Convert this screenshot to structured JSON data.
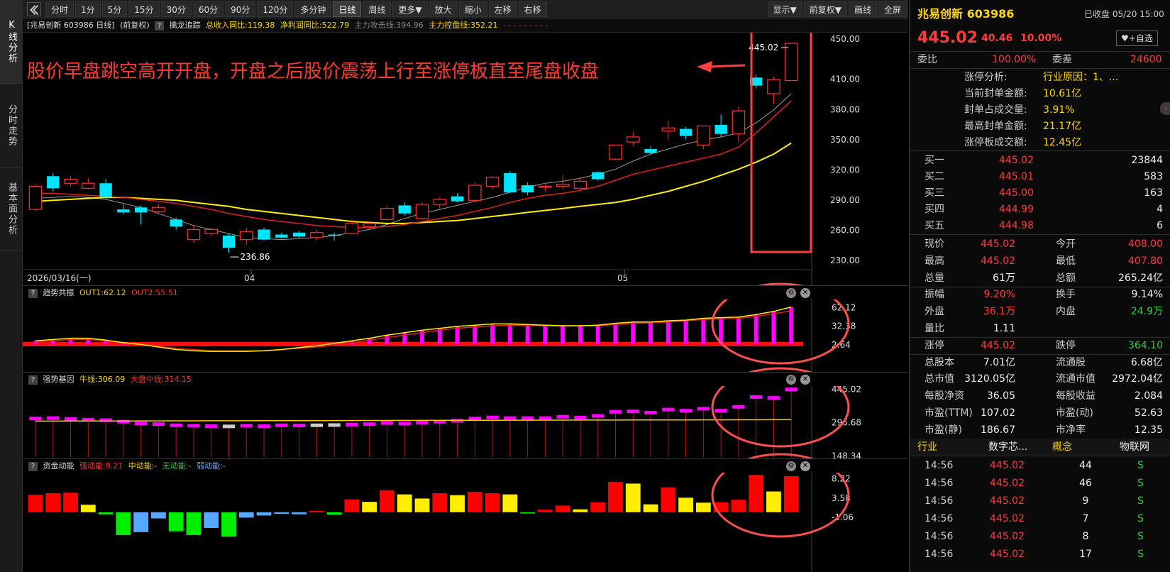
{
  "left_tabs": [
    "K线分析",
    "分时走势",
    "基本面分析"
  ],
  "toolbar": {
    "buttons": [
      "分时",
      "1分",
      "5分",
      "15分",
      "30分",
      "60分",
      "90分",
      "120分",
      "多分钟",
      "日线",
      "周线",
      "更多▼",
      "放大",
      "缩小",
      "左移",
      "右移"
    ],
    "active": "日线",
    "right_buttons": [
      "显示▼",
      "前复权▼",
      "画线",
      "全屏"
    ]
  },
  "infobar": {
    "title": "[兆易创新 603986 日线]",
    "adjust": "(前复权)",
    "indicator": "擒龙追踪",
    "revenue_yoy": "总收入同比:119.38",
    "profit_yoy": "净利润同比:522.79",
    "attack_line": "主力攻击线:394.96",
    "control_line": "主力控盘线:352.21",
    "extra": "- - - - - - - - -"
  },
  "annotation": {
    "text": "股价早盘跳空高开开盘，开盘之后股价震荡上行至涨停板直至尾盘收盘",
    "color": "#ff3b30"
  },
  "main_chart": {
    "y_ticks": [
      "450.00",
      "410.00",
      "380.00",
      "350.00",
      "320.00",
      "290.00",
      "260.00",
      "230.00"
    ],
    "x_labels": [
      "2026/03/16(一)",
      "04",
      "05"
    ],
    "high_label": "445.02",
    "low_label": "236.86"
  },
  "panel1": {
    "name": "趋势共振",
    "out1": "OUT1:62.12",
    "out2": "OUT2:55.51",
    "y_ticks": [
      "62.12",
      "32.38",
      "2.64"
    ]
  },
  "panel2": {
    "name": "强势基因",
    "bull": "牛线:306.09",
    "market": "大盘中线:314.15",
    "y_ticks": [
      "445.02",
      "296.68",
      "148.34"
    ]
  },
  "panel3": {
    "name": "资金动能",
    "strong": "强动能:8.21",
    "mid": "中动能:-",
    "none": "无动能:-",
    "weak": "弱动能:-",
    "y_ticks": [
      "8.22",
      "3.58",
      "-1.06"
    ]
  },
  "chart_data": {
    "type": "candlestick",
    "candles": [
      {
        "o": 280,
        "h": 305,
        "l": 278,
        "c": 303
      },
      {
        "o": 313,
        "h": 316,
        "l": 298,
        "c": 301
      },
      {
        "o": 306,
        "h": 313,
        "l": 303,
        "c": 310
      },
      {
        "o": 301,
        "h": 311,
        "l": 300,
        "c": 306
      },
      {
        "o": 306,
        "h": 310,
        "l": 290,
        "c": 292
      },
      {
        "o": 280,
        "h": 285,
        "l": 275,
        "c": 277
      },
      {
        "o": 282,
        "h": 284,
        "l": 265,
        "c": 277
      },
      {
        "o": 278,
        "h": 285,
        "l": 275,
        "c": 282
      },
      {
        "o": 270,
        "h": 272,
        "l": 260,
        "c": 263
      },
      {
        "o": 250,
        "h": 265,
        "l": 247,
        "c": 260
      },
      {
        "o": 256,
        "h": 262,
        "l": 253,
        "c": 260
      },
      {
        "o": 254,
        "h": 256,
        "l": 237,
        "c": 242
      },
      {
        "o": 250,
        "h": 262,
        "l": 245,
        "c": 258
      },
      {
        "o": 260,
        "h": 262,
        "l": 249,
        "c": 250
      },
      {
        "o": 255,
        "h": 257,
        "l": 251,
        "c": 252
      },
      {
        "o": 257,
        "h": 259,
        "l": 251,
        "c": 253
      },
      {
        "o": 252,
        "h": 260,
        "l": 249,
        "c": 257
      },
      {
        "o": 255,
        "h": 257,
        "l": 249,
        "c": 254
      },
      {
        "o": 256,
        "h": 270,
        "l": 255,
        "c": 266
      },
      {
        "o": 263,
        "h": 268,
        "l": 260,
        "c": 266
      },
      {
        "o": 270,
        "h": 284,
        "l": 268,
        "c": 281
      },
      {
        "o": 284,
        "h": 287,
        "l": 274,
        "c": 276
      },
      {
        "o": 271,
        "h": 287,
        "l": 270,
        "c": 285
      },
      {
        "o": 285,
        "h": 292,
        "l": 281,
        "c": 290
      },
      {
        "o": 293,
        "h": 296,
        "l": 287,
        "c": 288
      },
      {
        "o": 289,
        "h": 307,
        "l": 287,
        "c": 304
      },
      {
        "o": 303,
        "h": 313,
        "l": 300,
        "c": 312
      },
      {
        "o": 316,
        "h": 318,
        "l": 297,
        "c": 297
      },
      {
        "o": 304,
        "h": 307,
        "l": 294,
        "c": 297
      },
      {
        "o": 302,
        "h": 305,
        "l": 298,
        "c": 303
      },
      {
        "o": 303,
        "h": 314,
        "l": 300,
        "c": 305
      },
      {
        "o": 301,
        "h": 312,
        "l": 299,
        "c": 308
      },
      {
        "o": 317,
        "h": 318,
        "l": 309,
        "c": 310
      },
      {
        "o": 330,
        "h": 343,
        "l": 329,
        "c": 344
      },
      {
        "o": 347,
        "h": 357,
        "l": 343,
        "c": 352
      },
      {
        "o": 340,
        "h": 343,
        "l": 335,
        "c": 336
      },
      {
        "o": 358,
        "h": 368,
        "l": 349,
        "c": 361
      },
      {
        "o": 360,
        "h": 362,
        "l": 350,
        "c": 353
      },
      {
        "o": 344,
        "h": 361,
        "l": 340,
        "c": 363
      },
      {
        "o": 364,
        "h": 374,
        "l": 352,
        "c": 355
      },
      {
        "o": 355,
        "h": 382,
        "l": 347,
        "c": 378
      },
      {
        "o": 411,
        "h": 414,
        "l": 400,
        "c": 403
      },
      {
        "o": 395,
        "h": 412,
        "l": 385,
        "c": 409
      },
      {
        "o": 408,
        "h": 445.02,
        "l": 407.8,
        "c": 445.02
      }
    ],
    "ma_red": [
      296,
      296,
      295,
      294,
      293,
      292,
      290,
      288,
      286,
      283,
      280,
      276,
      273,
      270,
      268,
      266,
      264,
      263,
      262,
      262,
      263,
      265,
      268,
      271,
      274,
      278,
      282,
      287,
      291,
      294,
      296,
      299,
      303,
      309,
      315,
      319,
      323,
      327,
      331,
      335,
      342,
      356,
      372,
      388
    ],
    "ma_yellow": [
      288,
      289,
      290,
      291,
      292,
      292,
      291,
      290,
      289,
      287,
      285,
      283,
      280,
      278,
      276,
      274,
      272,
      270,
      268,
      267,
      266,
      266,
      267,
      268,
      269,
      271,
      273,
      275,
      277,
      279,
      281,
      283,
      285,
      287,
      290,
      294,
      298,
      303,
      308,
      314,
      320,
      327,
      335,
      346
    ],
    "ma_gray": [
      291,
      292,
      293,
      292,
      290,
      286,
      282,
      276,
      270,
      264,
      260,
      256,
      252,
      251,
      250,
      251,
      252,
      254,
      257,
      260,
      265,
      271,
      276,
      280,
      284,
      288,
      292,
      297,
      302,
      306,
      308,
      311,
      315,
      320,
      328,
      335,
      340,
      345,
      349,
      352,
      356,
      366,
      379,
      395
    ],
    "osc_out1": [
      8,
      10,
      12,
      12,
      9,
      5,
      2,
      -2,
      -6,
      -8,
      -9,
      -9,
      -9,
      -8,
      -6,
      -3,
      0,
      4,
      8,
      12,
      17,
      21,
      25,
      28,
      31,
      33,
      35,
      35,
      34,
      33,
      32,
      32,
      33,
      36,
      38,
      38,
      40,
      41,
      44,
      45,
      46,
      50,
      55,
      62
    ],
    "osc_out2": [
      6,
      8,
      10,
      10,
      8,
      5,
      2,
      -1,
      -4,
      -6,
      -8,
      -8,
      -8,
      -8,
      -6,
      -4,
      -2,
      1,
      5,
      9,
      13,
      17,
      21,
      25,
      28,
      30,
      32,
      33,
      33,
      32,
      32,
      32,
      32,
      34,
      36,
      37,
      38,
      40,
      42,
      43,
      44,
      47,
      51,
      56
    ],
    "gene_blocks": [
      {
        "v": 310,
        "c": "#ff00ff"
      },
      {
        "v": 312,
        "c": "#ff00ff"
      },
      {
        "v": 308,
        "c": "#ff00ff"
      },
      {
        "v": 305,
        "c": "#ff00ff"
      },
      {
        "v": 303,
        "c": "#ff00ff"
      },
      {
        "v": 296,
        "c": "#ff00ff"
      },
      {
        "v": 288,
        "c": "#ff00ff"
      },
      {
        "v": 285,
        "c": "#ff00ff"
      },
      {
        "v": 280,
        "c": "#ff00ff"
      },
      {
        "v": 278,
        "c": "#ff00ff"
      },
      {
        "v": 276,
        "c": "#ff00ff"
      },
      {
        "v": 275,
        "c": "#cccccc"
      },
      {
        "v": 278,
        "c": "#ff00ff"
      },
      {
        "v": 276,
        "c": "#ff00ff"
      },
      {
        "v": 280,
        "c": "#ff00ff"
      },
      {
        "v": 279,
        "c": "#ff00ff"
      },
      {
        "v": 280,
        "c": "#cccccc"
      },
      {
        "v": 281,
        "c": "#cccccc"
      },
      {
        "v": 283,
        "c": "#ff00ff"
      },
      {
        "v": 285,
        "c": "#ff00ff"
      },
      {
        "v": 290,
        "c": "#ff00ff"
      },
      {
        "v": 288,
        "c": "#ff00ff"
      },
      {
        "v": 291,
        "c": "#ff00ff"
      },
      {
        "v": 296,
        "c": "#ff00ff"
      },
      {
        "v": 300,
        "c": "#ff00ff"
      },
      {
        "v": 310,
        "c": "#ff00ff"
      },
      {
        "v": 315,
        "c": "#ff00ff"
      },
      {
        "v": 312,
        "c": "#ff00ff"
      },
      {
        "v": 312,
        "c": "#ff00ff"
      },
      {
        "v": 312,
        "c": "#ff00ff"
      },
      {
        "v": 318,
        "c": "#ff00ff"
      },
      {
        "v": 314,
        "c": "#ff00ff"
      },
      {
        "v": 322,
        "c": "#ff00ff"
      },
      {
        "v": 340,
        "c": "#ff00ff"
      },
      {
        "v": 342,
        "c": "#ff00ff"
      },
      {
        "v": 336,
        "c": "#ff00ff"
      },
      {
        "v": 350,
        "c": "#ff00ff"
      },
      {
        "v": 345,
        "c": "#ff00ff"
      },
      {
        "v": 354,
        "c": "#ff00ff"
      },
      {
        "v": 345,
        "c": "#ff00ff"
      },
      {
        "v": 362,
        "c": "#ff00ff"
      },
      {
        "v": 406,
        "c": "#ff00ff"
      },
      {
        "v": 402,
        "c": "#ff00ff"
      },
      {
        "v": 440,
        "c": "#ff00ff"
      }
    ],
    "fund_bars": [
      {
        "v": 4.2,
        "c": "#ff0000"
      },
      {
        "v": 4.6,
        "c": "#ff0000"
      },
      {
        "v": 4.7,
        "c": "#ff0000"
      },
      {
        "v": 1.8,
        "c": "#ffee00"
      },
      {
        "v": -0.5,
        "c": "#00ee00"
      },
      {
        "v": -5.5,
        "c": "#00ee00"
      },
      {
        "v": -4.8,
        "c": "#55aaff"
      },
      {
        "v": -1.5,
        "c": "#55aaff"
      },
      {
        "v": -4.6,
        "c": "#00ee00"
      },
      {
        "v": -5.5,
        "c": "#00ee00"
      },
      {
        "v": -3.8,
        "c": "#55aaff"
      },
      {
        "v": -5.9,
        "c": "#00ee00"
      },
      {
        "v": -1.3,
        "c": "#55aaff"
      },
      {
        "v": -0.8,
        "c": "#55aaff"
      },
      {
        "v": -0.4,
        "c": "#55aaff"
      },
      {
        "v": -0.5,
        "c": "#55aaff"
      },
      {
        "v": 0.3,
        "c": "#ff0000"
      },
      {
        "v": -0.6,
        "c": "#00ee00"
      },
      {
        "v": 3.1,
        "c": "#ff0000"
      },
      {
        "v": 2.5,
        "c": "#ffee00"
      },
      {
        "v": 5.3,
        "c": "#ff0000"
      },
      {
        "v": 4.3,
        "c": "#ffee00"
      },
      {
        "v": 3.3,
        "c": "#ffee00"
      },
      {
        "v": 4.6,
        "c": "#ff0000"
      },
      {
        "v": 4.1,
        "c": "#ffee00"
      },
      {
        "v": 4.9,
        "c": "#ff0000"
      },
      {
        "v": 4.6,
        "c": "#ff0000"
      },
      {
        "v": 4.3,
        "c": "#ffee00"
      },
      {
        "v": -0.3,
        "c": "#00ee00"
      },
      {
        "v": 0.6,
        "c": "#ff0000"
      },
      {
        "v": 1.6,
        "c": "#ff0000"
      },
      {
        "v": 0.7,
        "c": "#ffee00"
      },
      {
        "v": 2.4,
        "c": "#ff0000"
      },
      {
        "v": 7.3,
        "c": "#ff0000"
      },
      {
        "v": 6.9,
        "c": "#ffee00"
      },
      {
        "v": 1.9,
        "c": "#ffee00"
      },
      {
        "v": 6.0,
        "c": "#ff0000"
      },
      {
        "v": 3.5,
        "c": "#ffee00"
      },
      {
        "v": 2.3,
        "c": "#ffee00"
      },
      {
        "v": 2.4,
        "c": "#ff0000"
      },
      {
        "v": 3.0,
        "c": "#ff0000"
      },
      {
        "v": 9.0,
        "c": "#ff0000"
      },
      {
        "v": 5.0,
        "c": "#ffee00"
      },
      {
        "v": 8.7,
        "c": "#ff0000"
      }
    ]
  },
  "right_panel": {
    "stock_name": "兆易创新 603986",
    "status": "已收盘 05/20 15:00",
    "price": "445.02",
    "change": "40.46",
    "change_pct": "10.00%",
    "watch_btn": "+自选",
    "weibi_label": "委比",
    "weibi": "100.00%",
    "weicha_label": "委差",
    "weicha": "24600",
    "limit_info": [
      {
        "k": "涨停分析:",
        "v": "行业原因：1、..."
      },
      {
        "k": "当前封单金额:",
        "v": "10.61亿"
      },
      {
        "k": "封单占成交量:",
        "v": "3.91%"
      },
      {
        "k": "最高封单金额:",
        "v": "21.17亿"
      },
      {
        "k": "涨停板成交额:",
        "v": "12.45亿"
      }
    ],
    "bids": [
      {
        "k": "买一",
        "p": "445.02",
        "q": "23844"
      },
      {
        "k": "买二",
        "p": "445.01",
        "q": "583"
      },
      {
        "k": "买三",
        "p": "445.00",
        "q": "163"
      },
      {
        "k": "买四",
        "p": "444.99",
        "q": "4"
      },
      {
        "k": "买五",
        "p": "444.98",
        "q": "6"
      }
    ],
    "stats": [
      {
        "k1": "现价",
        "v1": "445.02",
        "c1": "red",
        "k2": "今开",
        "v2": "408.00",
        "c2": "red"
      },
      {
        "k1": "最高",
        "v1": "445.02",
        "c1": "red",
        "k2": "最低",
        "v2": "407.80",
        "c2": "red"
      },
      {
        "k1": "总量",
        "v1": "61万",
        "c1": "white",
        "k2": "总额",
        "v2": "265.24亿",
        "c2": "white"
      },
      {
        "k1": "振幅",
        "v1": "9.20%",
        "c1": "red",
        "k2": "换手",
        "v2": "9.14%",
        "c2": "white"
      },
      {
        "k1": "外盘",
        "v1": "36.1万",
        "c1": "red",
        "k2": "内盘",
        "v2": "24.9万",
        "c2": "green"
      },
      {
        "k1": "量比",
        "v1": "1.11",
        "c1": "white",
        "k2": "",
        "v2": "",
        "c2": "white"
      },
      {
        "k1": "涨停",
        "v1": "445.02",
        "c1": "red",
        "k2": "跌停",
        "v2": "364.10",
        "c2": "green"
      },
      {
        "k1": "总股本",
        "v1": "7.01亿",
        "c1": "white",
        "k2": "流通股",
        "v2": "6.68亿",
        "c2": "white"
      },
      {
        "k1": "总市值",
        "v1": "3120.05亿",
        "c1": "white",
        "k2": "流通市值",
        "v2": "2972.04亿",
        "c2": "white"
      },
      {
        "k1": "每股净资",
        "v1": "36.05",
        "c1": "white",
        "k2": "每股收益",
        "v2": "2.084",
        "c2": "white"
      },
      {
        "k1": "市盈(TTM)",
        "v1": "107.02",
        "c1": "white",
        "k2": "市盈(动)",
        "v2": "52.63",
        "c2": "white"
      },
      {
        "k1": "市盈(静)",
        "v1": "186.67",
        "c1": "white",
        "k2": "市净率",
        "v2": "12.35",
        "c2": "white"
      }
    ],
    "industry_label": "行业",
    "industry": "数字芯...",
    "concept_label": "概念",
    "concept": "物联网",
    "ticks": [
      {
        "t": "14:56",
        "p": "445.02",
        "q": "44",
        "s": "S"
      },
      {
        "t": "14:56",
        "p": "445.02",
        "q": "46",
        "s": "S"
      },
      {
        "t": "14:56",
        "p": "445.02",
        "q": "9",
        "s": "S"
      },
      {
        "t": "14:56",
        "p": "445.02",
        "q": "7",
        "s": "S"
      },
      {
        "t": "14:56",
        "p": "445.02",
        "q": "8",
        "s": "S"
      },
      {
        "t": "14:56",
        "p": "445.02",
        "q": "17",
        "s": "S"
      }
    ]
  }
}
